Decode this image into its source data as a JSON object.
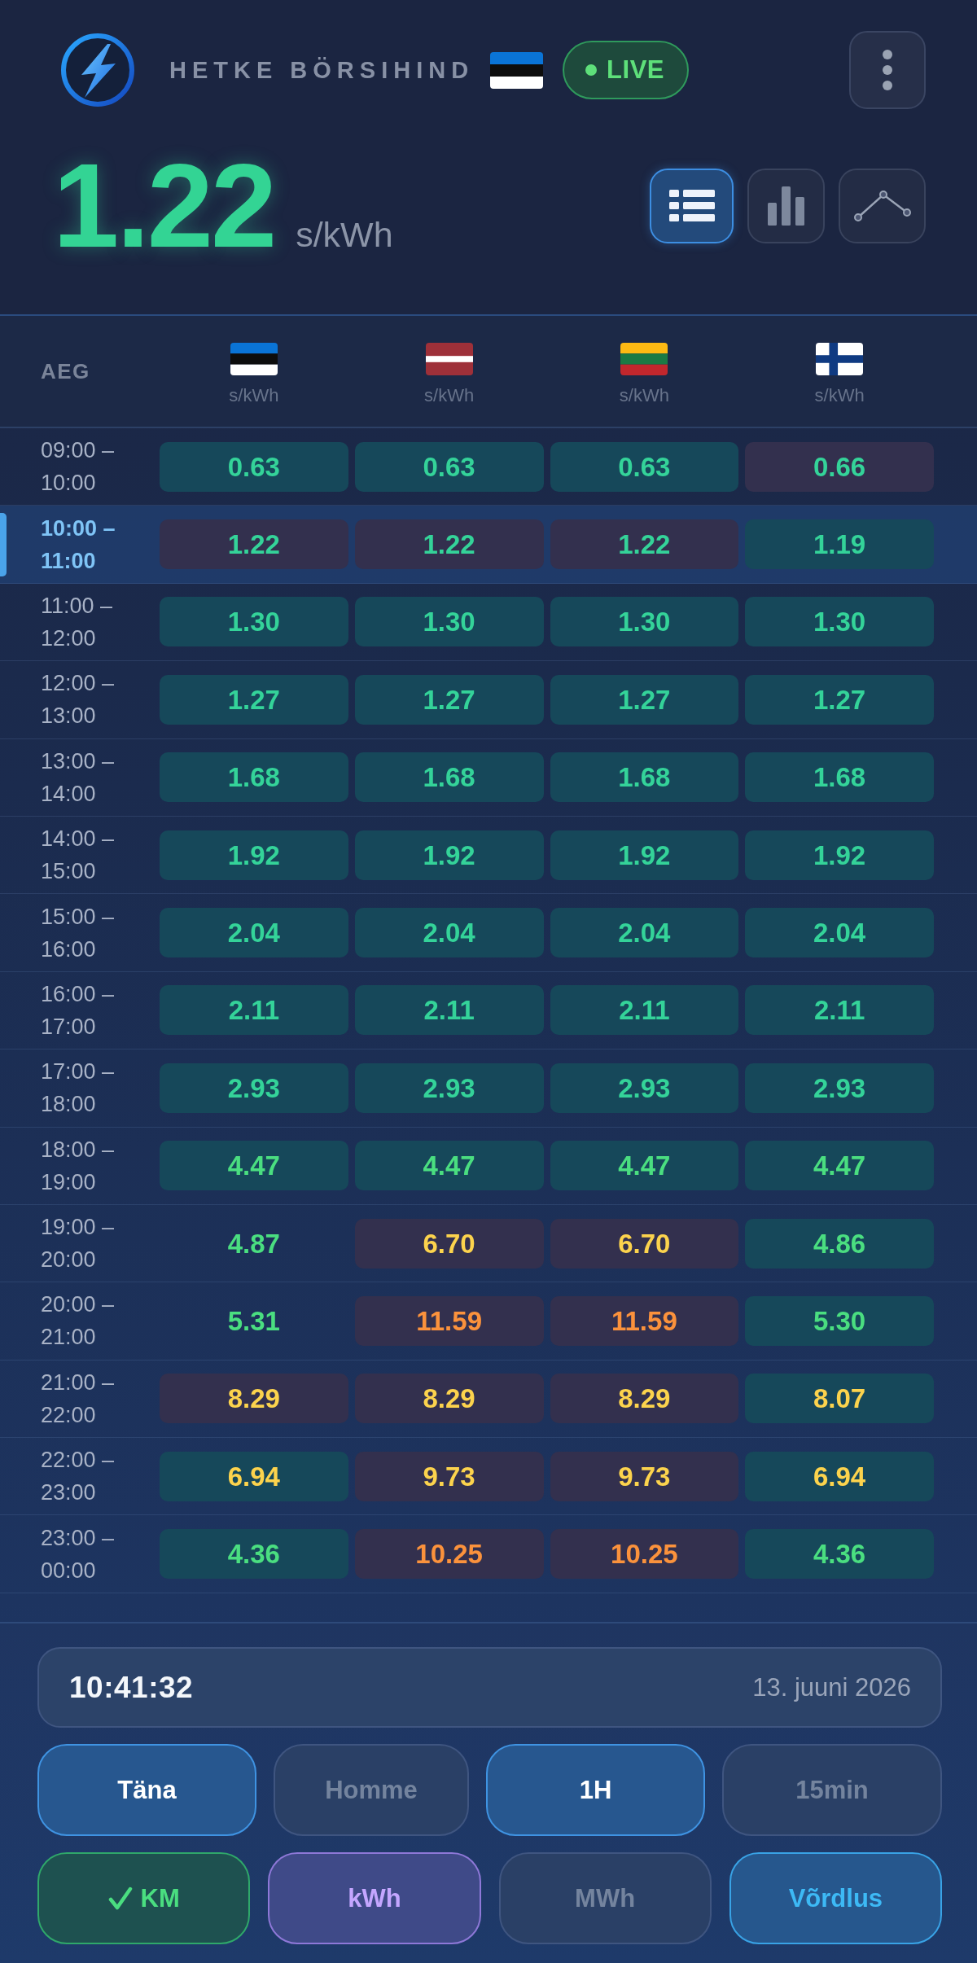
{
  "header": {
    "title": "HETKE BÖRSIHIND",
    "flag": {
      "kind": "estonia"
    },
    "live_badge": {
      "label": "LIVE"
    }
  },
  "price": {
    "value": "1.22",
    "unit": "s/kWh"
  },
  "view_modes": [
    {
      "kind": "list",
      "selected": true
    },
    {
      "kind": "bar",
      "selected": false
    },
    {
      "kind": "line",
      "selected": false
    }
  ],
  "table": {
    "time_header": "AEG",
    "columns": [
      {
        "kind": "estonia",
        "unit": "s/kWh"
      },
      {
        "kind": "latvia",
        "unit": "s/kWh"
      },
      {
        "kind": "lithuania",
        "unit": "s/kWh"
      },
      {
        "kind": "finland",
        "unit": "s/kWh"
      }
    ],
    "rows": [
      {
        "time": "09:00 – 10:00",
        "selected": false,
        "cells": [
          {
            "value": "0.63",
            "kind": "cheapest",
            "color": "#34d399"
          },
          {
            "value": "0.63",
            "kind": "cheapest",
            "color": "#34d399"
          },
          {
            "value": "0.63",
            "kind": "cheapest",
            "color": "#34d399"
          },
          {
            "value": "0.66",
            "kind": "pricier",
            "color": "#34d399"
          }
        ]
      },
      {
        "time": "10:00 – 11:00",
        "selected": true,
        "cells": [
          {
            "value": "1.22",
            "kind": "pricier",
            "color": "#34d399"
          },
          {
            "value": "1.22",
            "kind": "pricier",
            "color": "#34d399"
          },
          {
            "value": "1.22",
            "kind": "pricier",
            "color": "#34d399"
          },
          {
            "value": "1.19",
            "kind": "cheapest",
            "color": "#34d399"
          }
        ]
      },
      {
        "time": "11:00 – 12:00",
        "selected": false,
        "cells": [
          {
            "value": "1.30",
            "kind": "cheapest",
            "color": "#34d399"
          },
          {
            "value": "1.30",
            "kind": "cheapest",
            "color": "#34d399"
          },
          {
            "value": "1.30",
            "kind": "cheapest",
            "color": "#34d399"
          },
          {
            "value": "1.30",
            "kind": "cheapest",
            "color": "#34d399"
          }
        ]
      },
      {
        "time": "12:00 – 13:00",
        "selected": false,
        "cells": [
          {
            "value": "1.27",
            "kind": "cheapest",
            "color": "#34d399"
          },
          {
            "value": "1.27",
            "kind": "cheapest",
            "color": "#34d399"
          },
          {
            "value": "1.27",
            "kind": "cheapest",
            "color": "#34d399"
          },
          {
            "value": "1.27",
            "kind": "cheapest",
            "color": "#34d399"
          }
        ]
      },
      {
        "time": "13:00 – 14:00",
        "selected": false,
        "cells": [
          {
            "value": "1.68",
            "kind": "cheapest",
            "color": "#34d399"
          },
          {
            "value": "1.68",
            "kind": "cheapest",
            "color": "#34d399"
          },
          {
            "value": "1.68",
            "kind": "cheapest",
            "color": "#34d399"
          },
          {
            "value": "1.68",
            "kind": "cheapest",
            "color": "#34d399"
          }
        ]
      },
      {
        "time": "14:00 – 15:00",
        "selected": false,
        "cells": [
          {
            "value": "1.92",
            "kind": "cheapest",
            "color": "#34d399"
          },
          {
            "value": "1.92",
            "kind": "cheapest",
            "color": "#34d399"
          },
          {
            "value": "1.92",
            "kind": "cheapest",
            "color": "#34d399"
          },
          {
            "value": "1.92",
            "kind": "cheapest",
            "color": "#34d399"
          }
        ]
      },
      {
        "time": "15:00 – 16:00",
        "selected": false,
        "cells": [
          {
            "value": "2.04",
            "kind": "cheapest",
            "color": "#34d399"
          },
          {
            "value": "2.04",
            "kind": "cheapest",
            "color": "#34d399"
          },
          {
            "value": "2.04",
            "kind": "cheapest",
            "color": "#34d399"
          },
          {
            "value": "2.04",
            "kind": "cheapest",
            "color": "#34d399"
          }
        ]
      },
      {
        "time": "16:00 – 17:00",
        "selected": false,
        "cells": [
          {
            "value": "2.11",
            "kind": "cheapest",
            "color": "#34d399"
          },
          {
            "value": "2.11",
            "kind": "cheapest",
            "color": "#34d399"
          },
          {
            "value": "2.11",
            "kind": "cheapest",
            "color": "#34d399"
          },
          {
            "value": "2.11",
            "kind": "cheapest",
            "color": "#34d399"
          }
        ]
      },
      {
        "time": "17:00 – 18:00",
        "selected": false,
        "cells": [
          {
            "value": "2.93",
            "kind": "cheapest",
            "color": "#34d399"
          },
          {
            "value": "2.93",
            "kind": "cheapest",
            "color": "#34d399"
          },
          {
            "value": "2.93",
            "kind": "cheapest",
            "color": "#34d399"
          },
          {
            "value": "2.93",
            "kind": "cheapest",
            "color": "#34d399"
          }
        ]
      },
      {
        "time": "18:00 – 19:00",
        "selected": false,
        "cells": [
          {
            "value": "4.47",
            "kind": "cheapest",
            "color": "#4ade80"
          },
          {
            "value": "4.47",
            "kind": "cheapest",
            "color": "#4ade80"
          },
          {
            "value": "4.47",
            "kind": "cheapest",
            "color": "#4ade80"
          },
          {
            "value": "4.47",
            "kind": "cheapest",
            "color": "#4ade80"
          }
        ]
      },
      {
        "time": "19:00 – 20:00",
        "selected": false,
        "cells": [
          {
            "value": "4.87",
            "kind": "plain",
            "color": "#4ade80"
          },
          {
            "value": "6.70",
            "kind": "pricier",
            "color": "#fcd34d"
          },
          {
            "value": "6.70",
            "kind": "pricier",
            "color": "#fcd34d"
          },
          {
            "value": "4.86",
            "kind": "cheapest",
            "color": "#4ade80"
          }
        ]
      },
      {
        "time": "20:00 – 21:00",
        "selected": false,
        "cells": [
          {
            "value": "5.31",
            "kind": "plain",
            "color": "#4ade80"
          },
          {
            "value": "11.59",
            "kind": "pricier",
            "color": "#fb923c"
          },
          {
            "value": "11.59",
            "kind": "pricier",
            "color": "#fb923c"
          },
          {
            "value": "5.30",
            "kind": "cheapest",
            "color": "#4ade80"
          }
        ]
      },
      {
        "time": "21:00 – 22:00",
        "selected": false,
        "cells": [
          {
            "value": "8.29",
            "kind": "pricier",
            "color": "#fcd34d"
          },
          {
            "value": "8.29",
            "kind": "pricier",
            "color": "#fcd34d"
          },
          {
            "value": "8.29",
            "kind": "pricier",
            "color": "#fcd34d"
          },
          {
            "value": "8.07",
            "kind": "cheapest",
            "color": "#fcd34d"
          }
        ]
      },
      {
        "time": "22:00 – 23:00",
        "selected": false,
        "cells": [
          {
            "value": "6.94",
            "kind": "cheapest",
            "color": "#fcd34d"
          },
          {
            "value": "9.73",
            "kind": "pricier",
            "color": "#fcd34d"
          },
          {
            "value": "9.73",
            "kind": "pricier",
            "color": "#fcd34d"
          },
          {
            "value": "6.94",
            "kind": "cheapest",
            "color": "#fcd34d"
          }
        ]
      },
      {
        "time": "23:00 – 00:00",
        "selected": false,
        "cells": [
          {
            "value": "4.36",
            "kind": "cheapest",
            "color": "#4ade80"
          },
          {
            "value": "10.25",
            "kind": "pricier",
            "color": "#fb923c"
          },
          {
            "value": "10.25",
            "kind": "pricier",
            "color": "#fb923c"
          },
          {
            "value": "4.36",
            "kind": "cheapest",
            "color": "#4ade80"
          }
        ]
      }
    ]
  },
  "controls": {
    "clock": {
      "time": "10:41:32",
      "date": "13. juuni 2026"
    },
    "day_tabs": [
      {
        "label": "Täna",
        "selected": true
      },
      {
        "label": "Homme",
        "selected": false
      }
    ],
    "interval_tabs": [
      {
        "label": "1H",
        "selected": true
      },
      {
        "label": "15min",
        "selected": false
      }
    ],
    "vat_toggle": {
      "label": "KM",
      "checked": true
    },
    "unit_tabs": [
      {
        "label": "kWh",
        "selected": true
      },
      {
        "label": "MWh",
        "selected": false
      }
    ],
    "compare_toggle": {
      "label": "Võrdlus",
      "on": true
    }
  }
}
